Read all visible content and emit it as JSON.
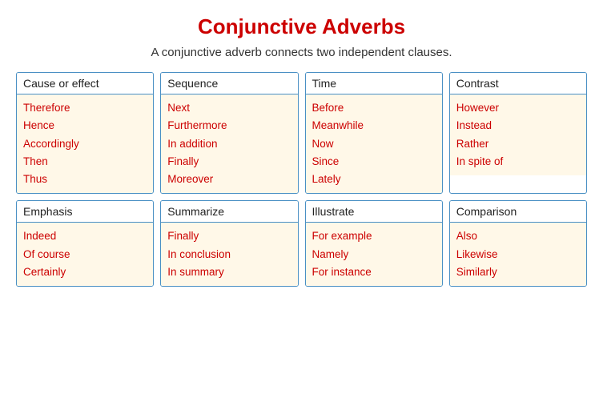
{
  "title": "Conjunctive Adverbs",
  "subtitle": "A conjunctive adverb connects two independent clauses.",
  "cards": [
    {
      "id": "cause-effect",
      "header": "Cause or effect",
      "items": [
        "Therefore",
        "Hence",
        "Accordingly",
        "Then",
        "Thus"
      ]
    },
    {
      "id": "sequence",
      "header": "Sequence",
      "items": [
        "Next",
        "Furthermore",
        "In addition",
        "Finally",
        "Moreover"
      ]
    },
    {
      "id": "time",
      "header": "Time",
      "items": [
        "Before",
        "Meanwhile",
        "Now",
        "Since",
        "Lately"
      ]
    },
    {
      "id": "contrast",
      "header": "Contrast",
      "items": [
        "However",
        "Instead",
        "Rather",
        "In spite of"
      ]
    },
    {
      "id": "emphasis",
      "header": "Emphasis",
      "items": [
        "Indeed",
        "Of course",
        "Certainly"
      ]
    },
    {
      "id": "summarize",
      "header": "Summarize",
      "items": [
        "Finally",
        "In conclusion",
        "In summary"
      ]
    },
    {
      "id": "illustrate",
      "header": "Illustrate",
      "items": [
        "For example",
        "Namely",
        "For instance"
      ]
    },
    {
      "id": "comparison",
      "header": "Comparison",
      "items": [
        "Also",
        "Likewise",
        "Similarly"
      ]
    }
  ]
}
